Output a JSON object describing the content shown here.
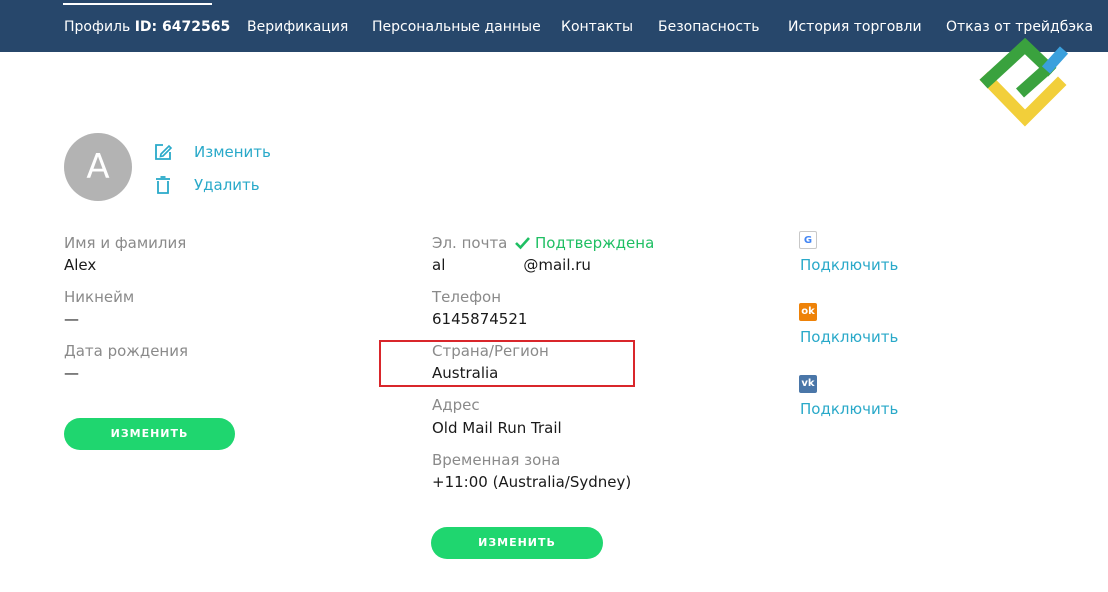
{
  "nav": {
    "profile_label": "Профиль",
    "profile_id": "ID: 6472565",
    "items": [
      "Верификация",
      "Персональные данные",
      "Контакты",
      "Безопасность",
      "История торговли",
      "Отказ от трейдбэка"
    ]
  },
  "avatar": {
    "initial": "A",
    "edit_label": "Изменить",
    "delete_label": "Удалить"
  },
  "personal": {
    "name_label": "Имя и фамилия",
    "name_value": "Alex",
    "nickname_label": "Никнейм",
    "nickname_value": "—",
    "birth_label": "Дата рождения",
    "birth_value": "—",
    "button_label": "ИЗМЕНИТЬ"
  },
  "contact": {
    "email_label": "Эл. почта",
    "email_status": "Подтверждена",
    "email_prefix": "al",
    "email_suffix": "@mail.ru",
    "phone_label": "Телефон",
    "phone_value": "6145874521",
    "country_label": "Страна/Регион",
    "country_value": "Australia",
    "address_label": "Адрес",
    "address_value": "Old Mail Run Trail",
    "timezone_label": "Временная зона",
    "timezone_value": "+11:00 (Australia/Sydney)",
    "button_label": "ИЗМЕНИТЬ"
  },
  "social": [
    {
      "icon": "google-icon",
      "glyph": "G",
      "link": "Подключить"
    },
    {
      "icon": "odnoklassniki-icon",
      "glyph": "ok",
      "link": "Подключить"
    },
    {
      "icon": "vk-icon",
      "glyph": "vk",
      "link": "Подключить"
    }
  ],
  "colors": {
    "nav_bg": "#27476b",
    "accent": "#1fd66f",
    "link": "#29a9c9",
    "verified": "#1fbf63",
    "highlight": "#d9262b"
  }
}
